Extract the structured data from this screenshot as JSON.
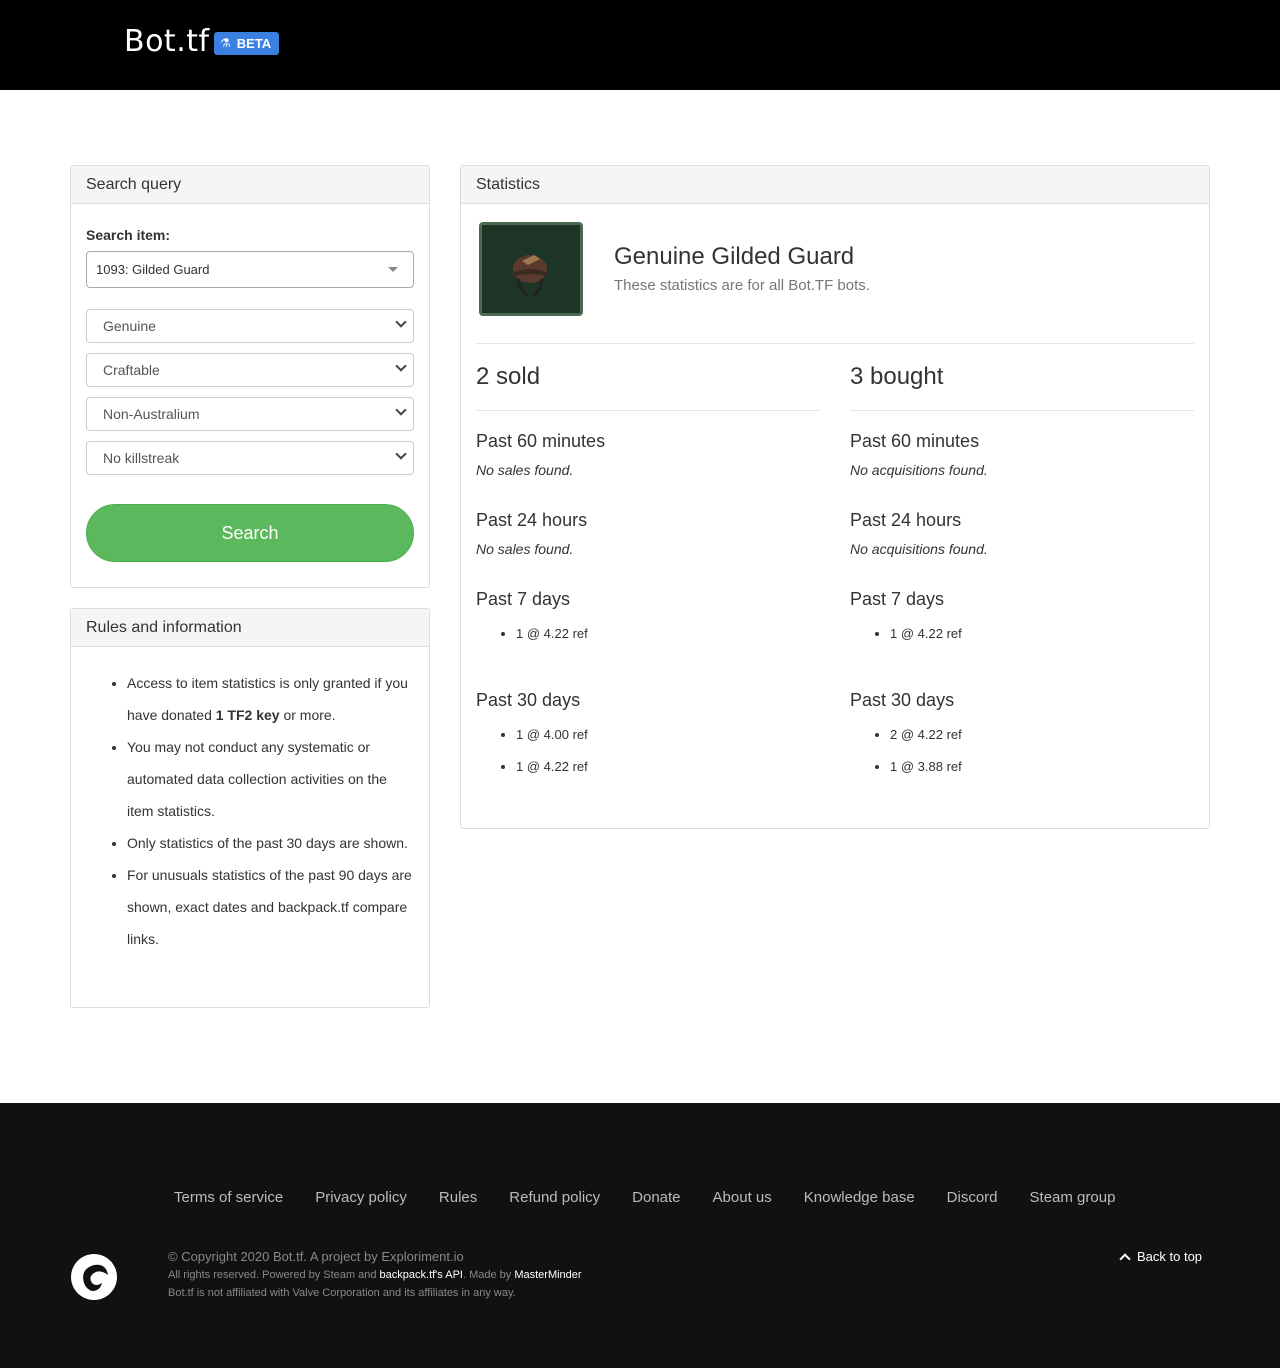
{
  "header": {
    "brand": "Bot.tf",
    "beta_label": "BETA",
    "beta_icon": "flask-icon"
  },
  "search_panel": {
    "title": "Search query",
    "item_label": "Search item:",
    "item_value": "1093: Gilded Guard",
    "quality": "Genuine",
    "craftable": "Craftable",
    "australium": "Non-Australium",
    "killstreak": "No killstreak",
    "search_button": "Search"
  },
  "rules_panel": {
    "title": "Rules and information",
    "rule1_pre": "Access to item statistics is only granted if you have donated ",
    "rule1_bold": "1 TF2 key",
    "rule1_post": " or more.",
    "rule2": "You may not conduct any systematic or automated data collection activities on the item statistics.",
    "rule3": "Only statistics of the past 30 days are shown.",
    "rule4": "For unusuals statistics of the past 90 days are shown, exact dates and backpack.tf compare links."
  },
  "stats_panel": {
    "title": "Statistics",
    "item_name": "Genuine Gilded Guard",
    "item_sub": "These statistics are for all Bot.TF bots.",
    "sold": {
      "count": "2 sold",
      "p60": "Past 60 minutes",
      "p60_none": "No sales found.",
      "p24": "Past 24 hours",
      "p24_none": "No sales found.",
      "p7": "Past 7 days",
      "p7_entries": [
        "1 @ 4.22 ref"
      ],
      "p30": "Past 30 days",
      "p30_entries": [
        "1 @ 4.00 ref",
        "1 @ 4.22 ref"
      ]
    },
    "bought": {
      "count": "3 bought",
      "p60": "Past 60 minutes",
      "p60_none": "No acquisitions found.",
      "p24": "Past 24 hours",
      "p24_none": "No acquisitions found.",
      "p7": "Past 7 days",
      "p7_entries": [
        "1 @ 4.22 ref"
      ],
      "p30": "Past 30 days",
      "p30_entries": [
        "2 @ 4.22 ref",
        "1 @ 3.88 ref"
      ]
    }
  },
  "footer": {
    "links": [
      "Terms of service",
      "Privacy policy",
      "Rules",
      "Refund policy",
      "Donate",
      "About us",
      "Knowledge base",
      "Discord",
      "Steam group"
    ],
    "copyright": "© Copyright 2020 Bot.tf. A project by Exploriment.io",
    "rights_pre": "All rights reserved. Powered by Steam and ",
    "rights_api": "backpack.tf's API",
    "rights_mid": ". Made by ",
    "rights_author": "MasterMinder",
    "affiliation": "Bot.tf is not affiliated with Valve Corporation and its affiliates in any way.",
    "back_to_top": "Back to top"
  }
}
